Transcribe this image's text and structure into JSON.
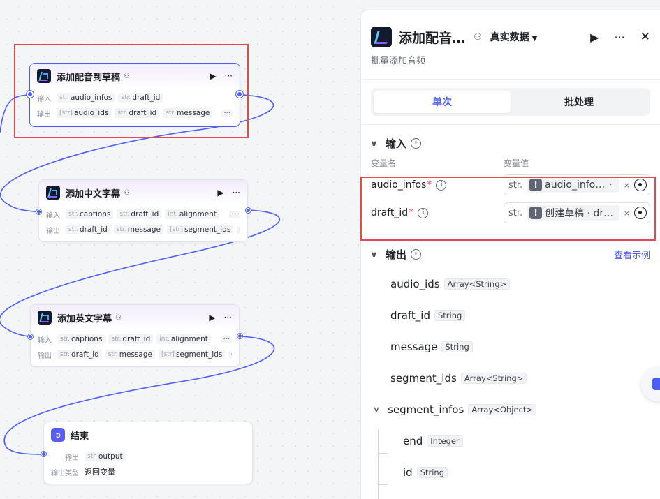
{
  "nodes": {
    "node1": {
      "title": "添加配音到草稿",
      "input_label": "输入",
      "output_label": "输出",
      "inputs": [
        {
          "type": "str.",
          "name": "audio_infos"
        },
        {
          "type": "str.",
          "name": "draft_id"
        }
      ],
      "outputs": [
        {
          "type": "[str]",
          "name": "audio_ids"
        },
        {
          "type": "str.",
          "name": "draft_id"
        },
        {
          "type": "str.",
          "name": "message"
        }
      ],
      "more": "···"
    },
    "node2": {
      "title": "添加中文字幕",
      "input_label": "输入",
      "output_label": "输出",
      "inputs": [
        {
          "type": "str.",
          "name": "captions"
        },
        {
          "type": "str.",
          "name": "draft_id"
        },
        {
          "type": "int.",
          "name": "alignment"
        }
      ],
      "outputs": [
        {
          "type": "str.",
          "name": "draft_id"
        },
        {
          "type": "str.",
          "name": "message"
        },
        {
          "type": "[str]",
          "name": "segment_ids"
        }
      ],
      "more": "···"
    },
    "node3": {
      "title": "添加英文字幕",
      "input_label": "输入",
      "output_label": "输出",
      "inputs": [
        {
          "type": "str.",
          "name": "captions"
        },
        {
          "type": "str.",
          "name": "draft_id"
        },
        {
          "type": "int.",
          "name": "alignment"
        }
      ],
      "outputs": [
        {
          "type": "str.",
          "name": "draft_id"
        },
        {
          "type": "str.",
          "name": "message"
        },
        {
          "type": "[str]",
          "name": "segment_ids"
        }
      ],
      "more": "···"
    },
    "end": {
      "title": "结束",
      "output_label": "输出",
      "output": {
        "type": "str.",
        "name": "output"
      },
      "output_type_label": "输出类型",
      "output_type_value": "返回变量"
    }
  },
  "panel": {
    "title": "添加配音…",
    "data_mode": "真实数据",
    "description": "批量添加音频",
    "tabs": [
      {
        "label": "单次",
        "active": true
      },
      {
        "label": "批处理",
        "active": false
      }
    ],
    "input_section": {
      "title": "输入",
      "col_name": "变量名",
      "col_value": "变量值",
      "params": [
        {
          "name": "audio_infos",
          "required": "*",
          "type": "str.",
          "value": "audio_info…",
          "extra": "·"
        },
        {
          "name": "draft_id",
          "required": "*",
          "type": "str.",
          "value": "创建草稿 · dr…",
          "extra": ""
        }
      ]
    },
    "output_section": {
      "title": "输出",
      "link": "查看示例",
      "fields": [
        {
          "name": "audio_ids",
          "type": "Array<String>"
        },
        {
          "name": "draft_id",
          "type": "String"
        },
        {
          "name": "message",
          "type": "String"
        },
        {
          "name": "segment_ids",
          "type": "Array<String>"
        },
        {
          "name": "segment_infos",
          "type": "Array<Object>"
        }
      ],
      "children": [
        {
          "name": "end",
          "type": "Integer"
        },
        {
          "name": "id",
          "type": "String"
        }
      ]
    }
  },
  "icons": {
    "run": "▶",
    "more": "···",
    "close": "✕",
    "clear": "×",
    "caret": "▼",
    "chevron": "∨",
    "info": "i",
    "warning": "!"
  },
  "colors": {
    "accent": "#4e5ef0",
    "highlight_box": "#e5484d",
    "required": "#e5484d"
  }
}
